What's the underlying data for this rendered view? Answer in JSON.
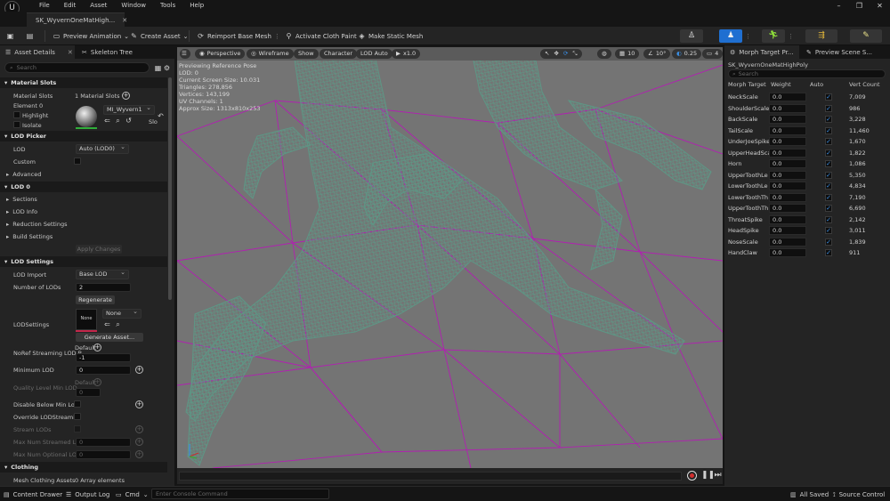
{
  "menubar": {
    "items": [
      "File",
      "Edit",
      "Asset",
      "Window",
      "Tools",
      "Help"
    ]
  },
  "document_tab": {
    "label": "SK_WyvernOneMatHigh..."
  },
  "toolbar": {
    "preview_animation": "Preview Animation",
    "create_asset": "Create Asset",
    "reimport": "Reimport Base Mesh",
    "cloth_paint": "Activate Cloth Paint",
    "static_mesh": "Make Static Mesh"
  },
  "left_panel": {
    "tabs": [
      "Asset Details",
      "Skeleton Tree"
    ],
    "search_placeholder": "Search",
    "material_slots": {
      "header": "Material Slots",
      "label": "Material Slots",
      "value": "1 Material Slots",
      "element": "Element 0",
      "material_name": "MI_Wyvern1",
      "highlight": "Highlight",
      "isolate": "Isolate",
      "slot_short": "Slo"
    },
    "lod_picker": {
      "header": "LOD Picker",
      "lod_label": "LOD",
      "lod_value": "Auto (LOD0)",
      "custom_label": "Custom",
      "advanced": "Advanced"
    },
    "lod0": {
      "header": "LOD 0",
      "items": [
        "Sections",
        "LOD Info",
        "Reduction Settings",
        "Build Settings"
      ],
      "apply": "Apply Changes"
    },
    "lod_settings": {
      "header": "LOD Settings",
      "lod_import_label": "LOD Import",
      "lod_import_value": "Base LOD",
      "num_lods_label": "Number of LODs",
      "num_lods_value": "2",
      "regenerate": "Regenerate",
      "lodsettings_label": "LODSettings",
      "lodsettings_thumb": "None",
      "lodsettings_value": "None",
      "generate_asset": "Generate Asset...",
      "noref_label": "NoRef Streaming LOD B",
      "noref_default": "Default",
      "noref_value": "-1",
      "min_lod_label": "Minimum LOD",
      "min_lod_value": "0",
      "quality_label": "Quality Level Min LOD",
      "quality_value": "0",
      "quality_default": "Default",
      "disable_below_label": "Disable Below Min Lo...",
      "override_label": "Override LODStreami...",
      "stream_lods_label": "Stream LODs",
      "max_num_streamed_label": "Max Num Streamed L...",
      "max_num_streamed_value": "0",
      "max_num_optional_label": "Max Num Optional LO...",
      "max_num_optional_value": "0"
    },
    "clothing": {
      "header": "Clothing",
      "mesh_label": "Mesh Clothing Assets",
      "mesh_value": "0 Array elements"
    }
  },
  "viewport": {
    "toolbar": {
      "perspective": "Perspective",
      "wireframe": "Wireframe",
      "show": "Show",
      "character": "Character",
      "lod": "LOD Auto",
      "speed": "x1.0",
      "grid": "10",
      "angle": "10°",
      "scale": "0.25",
      "cams": "4"
    },
    "info": [
      "Previewing Reference Pose",
      "LOD: 0",
      "Current Screen Size: 10.031",
      "Triangles: 278,856",
      "Vertices: 143,199",
      "UV Channels: 1",
      "Approx Size: 1313x810x253"
    ]
  },
  "right_panel": {
    "tabs": [
      "Morph Target Pr...",
      "Preview Scene S..."
    ],
    "asset_name": "SK_WyvernOneMatHighPoly",
    "search_placeholder": "Search",
    "columns": [
      "Morph Target",
      "Weight",
      "Auto",
      "Vert Count"
    ],
    "morphs": [
      {
        "name": "NeckScale",
        "weight": "0.0",
        "verts": "7,009"
      },
      {
        "name": "ShoulderScale",
        "weight": "0.0",
        "verts": "986"
      },
      {
        "name": "BackScale",
        "weight": "0.0",
        "verts": "3,228"
      },
      {
        "name": "TailScale",
        "weight": "0.0",
        "verts": "11,460"
      },
      {
        "name": "UnderJoeSpike",
        "weight": "0.0",
        "verts": "1,670"
      },
      {
        "name": "UpperHeadSca",
        "weight": "0.0",
        "verts": "1,822"
      },
      {
        "name": "Horn",
        "weight": "0.0",
        "verts": "1,086"
      },
      {
        "name": "UpperToothLe",
        "weight": "0.0",
        "verts": "5,350"
      },
      {
        "name": "LowerToothLe",
        "weight": "0.0",
        "verts": "4,834"
      },
      {
        "name": "LowerToothTh",
        "weight": "0.0",
        "verts": "7,190"
      },
      {
        "name": "UpperToothTh",
        "weight": "0.0",
        "verts": "6,690"
      },
      {
        "name": "ThroatSpike",
        "weight": "0.0",
        "verts": "2,142"
      },
      {
        "name": "HeadSpike",
        "weight": "0.0",
        "verts": "3,011"
      },
      {
        "name": "NoseScale",
        "weight": "0.0",
        "verts": "1,839"
      },
      {
        "name": "HandClaw",
        "weight": "0.0",
        "verts": "911"
      }
    ]
  },
  "statusbar": {
    "content_drawer": "Content Drawer",
    "output_log": "Output Log",
    "cmd": "Cmd",
    "console_placeholder": "Enter Console Command",
    "all_saved": "All Saved",
    "source_control": "Source Control"
  },
  "colors": {
    "accent": "#1f6fd1",
    "wire_mesh": "#5e9685",
    "grid_lines": "#b21fb2",
    "viewport_bg": "#747474"
  }
}
